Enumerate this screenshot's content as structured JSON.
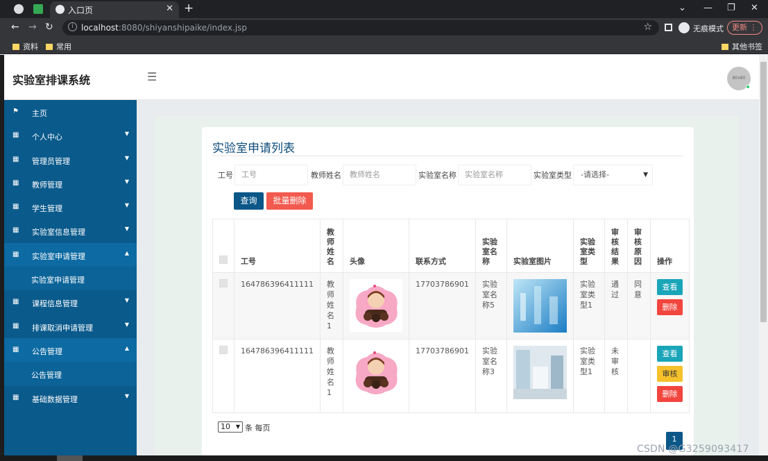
{
  "browser": {
    "tab_title": "入口页",
    "url_host": "localhost",
    "url_rest": ":8080/shiyanshipaike/index.jsp",
    "incognito_label": "无痕模式",
    "update_label": "更新",
    "bookmarks": [
      "资料",
      "常用"
    ],
    "other_bookmarks": "其他书签"
  },
  "app": {
    "title": "实验室排课系统",
    "avatar_text": "80x80"
  },
  "sidebar": {
    "items": [
      {
        "label": "主页",
        "icon": "flag-icon",
        "arrow": ""
      },
      {
        "label": "个人中心",
        "icon": "grid-icon",
        "arrow": "▼"
      },
      {
        "label": "管理员管理",
        "icon": "grid-icon",
        "arrow": "▼"
      },
      {
        "label": "教师管理",
        "icon": "grid-icon",
        "arrow": "▼"
      },
      {
        "label": "学生管理",
        "icon": "grid-icon",
        "arrow": "▼"
      },
      {
        "label": "实验室信息管理",
        "icon": "grid-icon",
        "arrow": "▼"
      },
      {
        "label": "实验室申请管理",
        "icon": "grid-icon",
        "arrow": "▲"
      },
      {
        "label": "实验室申请管理",
        "sub": true
      },
      {
        "label": "课程信息管理",
        "icon": "grid-icon",
        "arrow": "▼"
      },
      {
        "label": "排课取消申请管理",
        "icon": "grid-icon",
        "arrow": "▼"
      },
      {
        "label": "公告管理",
        "icon": "grid-icon",
        "arrow": "▲"
      },
      {
        "label": "公告管理",
        "sub": true
      },
      {
        "label": "基础数据管理",
        "icon": "grid-icon",
        "arrow": "▼"
      }
    ]
  },
  "page": {
    "title": "实验室申请列表",
    "filters": {
      "gonghao_label": "工号",
      "gonghao_placeholder": "工号",
      "teacher_label": "教师姓名",
      "teacher_placeholder": "教师姓名",
      "lab_label": "实验室名称",
      "lab_placeholder": "实验室名称",
      "type_label": "实验室类型",
      "type_value": "-请选择-"
    },
    "search_button": "查询",
    "batch_delete_button": "批量删除",
    "columns": [
      "工号",
      "教师姓名",
      "头像",
      "联系方式",
      "实验室名称",
      "实验室图片",
      "实验室类型",
      "审核结果",
      "审核原因",
      "操作"
    ],
    "rows": [
      {
        "gonghao": "164786396411111",
        "teacher": "教师姓名1",
        "phone": "17703786901",
        "lab": "实验室名称5",
        "lab_type": "实验室类型1",
        "result": "通过",
        "reason": "同意",
        "actions": [
          "查看",
          "删除"
        ]
      },
      {
        "gonghao": "164786396411111",
        "teacher": "教师姓名1",
        "phone": "17703786901",
        "lab": "实验室名称3",
        "lab_type": "实验室类型1",
        "result": "未审核",
        "reason": "",
        "actions": [
          "查看",
          "审核",
          "删除"
        ]
      }
    ],
    "page_size": "10",
    "page_size_suffix": "条 每页",
    "current_page": "1"
  },
  "watermark": "CSDN @G3259093417",
  "colors": {
    "sidebar": "#0a5a8c",
    "primary": "#0b5788",
    "danger": "#f25a4f",
    "info": "#1aa5b9",
    "warning": "#f6c12b"
  }
}
